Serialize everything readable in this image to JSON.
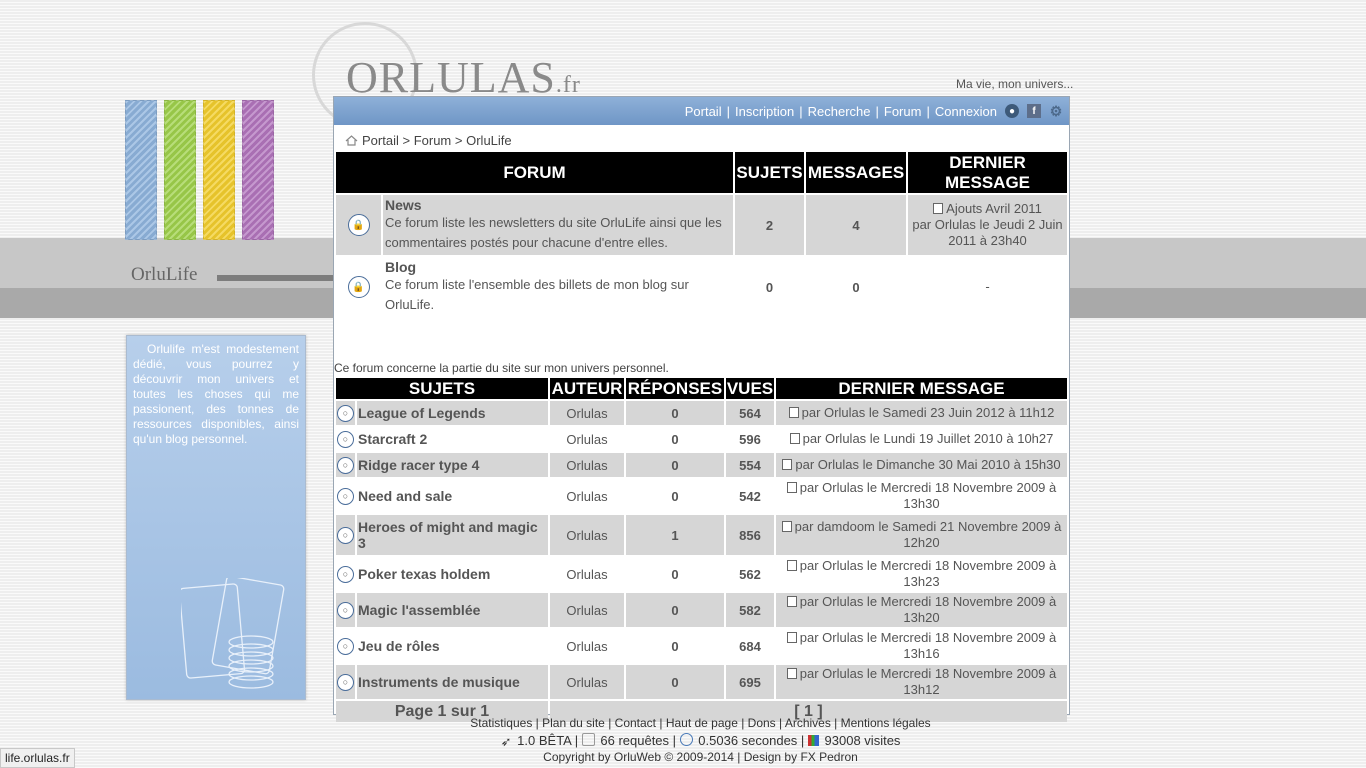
{
  "brand": {
    "logo_text": "ORLULAS",
    "logo_tld": ".fr",
    "tagline": "Ma vie, mon univers...",
    "section_label": "OrluLife"
  },
  "colors": {
    "pencils": [
      "#8fb4dd",
      "#9fd14c",
      "#f2cd2d",
      "#b275bd"
    ],
    "nav_bg": "#7aa0cd",
    "header_bg": "#000000",
    "row_alt": "#d6d6d6"
  },
  "sidebar": {
    "text": "Orlulife m'est modestement dédié, vous pourrez y découvrir mon univers et toutes les choses qui me passionent, des tonnes de ressources disponibles, ainsi qu'un blog personnel."
  },
  "nav": {
    "links": [
      "Portail",
      "Inscription",
      "Recherche",
      "Forum",
      "Connexion"
    ],
    "icons": [
      "user-icon",
      "facebook-icon",
      "settings-icon"
    ]
  },
  "breadcrumb": {
    "items": [
      "Portail",
      "Forum",
      "OrluLife"
    ],
    "separator": ">"
  },
  "forums": {
    "headers": {
      "forum": "FORUM",
      "sujets": "SUJETS",
      "messages": "MESSAGES",
      "dernier": "DERNIER MESSAGE"
    },
    "rows": [
      {
        "title": "News",
        "desc": "Ce forum liste les newsletters du site OrluLife ainsi que les commentaires postés pour chacune d'entre elles.",
        "sujets": "2",
        "messages": "4",
        "last": "Ajouts Avril 2011",
        "last_by": "par Orlulas le Jeudi 2 Juin 2011 à 23h40"
      },
      {
        "title": "Blog",
        "desc": "Ce forum liste l'ensemble des billets de mon blog sur OrluLife.",
        "sujets": "0",
        "messages": "0",
        "last": "-",
        "last_by": ""
      }
    ]
  },
  "note": "Ce forum concerne la partie du site sur mon univers personnel.",
  "topics": {
    "headers": {
      "sujets": "SUJETS",
      "auteur": "AUTEUR",
      "reponses": "RÉPONSES",
      "vues": "VUES",
      "dernier": "DERNIER MESSAGE"
    },
    "rows": [
      {
        "title": "League of Legends",
        "author": "Orlulas",
        "replies": "0",
        "views": "564",
        "last": "par Orlulas le Samedi 23 Juin 2012 à 11h12"
      },
      {
        "title": "Starcraft 2",
        "author": "Orlulas",
        "replies": "0",
        "views": "596",
        "last": "par Orlulas le Lundi 19 Juillet 2010 à 10h27"
      },
      {
        "title": "Ridge racer type 4",
        "author": "Orlulas",
        "replies": "0",
        "views": "554",
        "last": "par Orlulas le Dimanche 30 Mai 2010 à 15h30"
      },
      {
        "title": "Need and sale",
        "author": "Orlulas",
        "replies": "0",
        "views": "542",
        "last": "par Orlulas le Mercredi 18 Novembre 2009 à 13h30"
      },
      {
        "title": "Heroes of might and magic 3",
        "author": "Orlulas",
        "replies": "1",
        "views": "856",
        "last": "par damdoom le Samedi 21 Novembre 2009 à 12h20"
      },
      {
        "title": "Poker texas holdem",
        "author": "Orlulas",
        "replies": "0",
        "views": "562",
        "last": "par Orlulas le Mercredi 18 Novembre 2009 à 13h23"
      },
      {
        "title": "Magic l'assemblée",
        "author": "Orlulas",
        "replies": "0",
        "views": "582",
        "last": "par Orlulas le Mercredi 18 Novembre 2009 à 13h20"
      },
      {
        "title": "Jeu de rôles",
        "author": "Orlulas",
        "replies": "0",
        "views": "684",
        "last": "par Orlulas le Mercredi 18 Novembre 2009 à 13h16"
      },
      {
        "title": "Instruments de musique",
        "author": "Orlulas",
        "replies": "0",
        "views": "695",
        "last": "par Orlulas le Mercredi 18 Novembre 2009 à 13h12"
      }
    ],
    "pagination": {
      "label": "Page 1 sur 1",
      "pages": "[ 1 ]"
    }
  },
  "footer": {
    "links": [
      "Statistiques",
      "Plan du site",
      "Contact",
      "Haut de page",
      "Dons",
      "Archives",
      "Mentions légales"
    ],
    "version": "1.0 BÊTA",
    "requests": "66 requêtes",
    "time": "0.5036 secondes",
    "visits": "93008 visites",
    "copyright_prefix": "Copyright by",
    "copyright_name": "OrluWeb",
    "copyright_years": "© 2009-2014 | Design by",
    "designer": "FX Pedron"
  },
  "statusbar": {
    "url": "life.orlulas.fr"
  }
}
